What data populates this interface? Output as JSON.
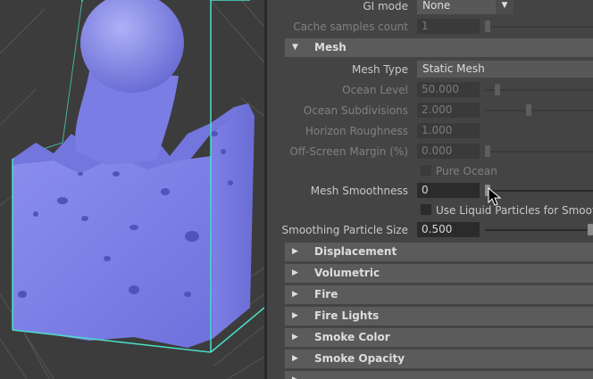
{
  "gi_row": {
    "label": "GI mode",
    "value": "None"
  },
  "cache_row": {
    "label": "Cache samples count",
    "value": "1"
  },
  "mesh_section": {
    "label": "Mesh"
  },
  "mesh_type": {
    "label": "Mesh Type",
    "value": "Static Mesh"
  },
  "ocean_level": {
    "label": "Ocean Level",
    "value": "50.000"
  },
  "ocean_subdivisions": {
    "label": "Ocean Subdivisions",
    "value": "2.000"
  },
  "horizon_roughness": {
    "label": "Horizon Roughness",
    "value": "1.000"
  },
  "off_screen_margin": {
    "label": "Off-Screen Margin (%)",
    "value": "0.000"
  },
  "pure_ocean": {
    "label": "Pure Ocean",
    "checked": false
  },
  "mesh_smoothness": {
    "label": "Mesh Smoothness",
    "value": "0"
  },
  "liquid_particles": {
    "label": "Use Liquid Particles for Smoot",
    "checked": false
  },
  "smoothing_particle_size": {
    "label": "Smoothing Particle Size",
    "value": "0.500"
  },
  "sections": [
    {
      "label": "Displacement"
    },
    {
      "label": "Volumetric"
    },
    {
      "label": "Fire"
    },
    {
      "label": "Fire Lights"
    },
    {
      "label": "Smoke Color"
    },
    {
      "label": "Smoke Opacity"
    }
  ],
  "icons": {
    "collapsed": "triangle-right-icon",
    "expanded": "triangle-down-icon",
    "dropdown": "triangle-down-icon",
    "cursor": "mouse-pointer-icon"
  },
  "colors": {
    "panel_bg": "#444444",
    "field_bg": "#2b2b2b",
    "section_bg": "#5b5b5b",
    "mesh_color": "#7b7ee6",
    "bbox_color": "#49e0c8",
    "viewport_bg": "#3c3c3c"
  }
}
